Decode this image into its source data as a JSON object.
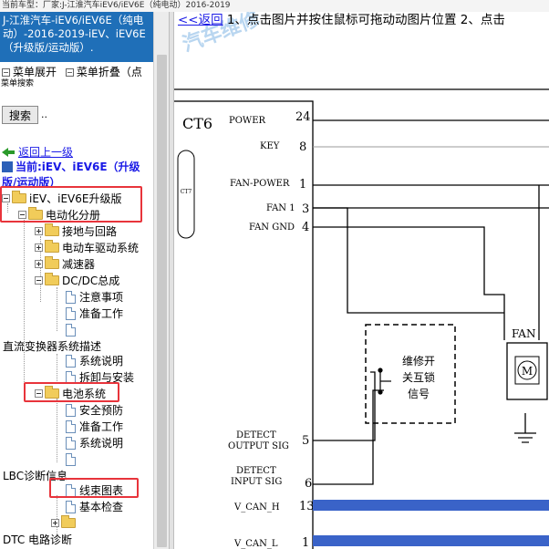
{
  "topbar": {
    "text": "当前车型：厂家:J-江淮汽车iEV6/iEV6E（纯电动）2016-2019"
  },
  "left": {
    "title": "J-江淮汽车-iEV6/iEV6E（纯电动）-2016-2019-iEV、iEV6E（升级版/运动版）.",
    "menu_expand": "菜单展开",
    "menu_collapse": "菜单折叠（点",
    "search_label": "菜单搜索",
    "search_button": "搜索",
    "search_dots": "..",
    "back_link": "返回上一级",
    "current_label": "当前:iEV、iEV6E（升级版/运动版）",
    "tree": {
      "root": "iEV、iEV6E升级版",
      "electrification": "电动化分册",
      "grounding": "接地与回路",
      "motor_drive": "电动车驱动系统",
      "reducer": "减速器",
      "dcdc": "DC/DC总成",
      "notes": "注意事项",
      "prep": "准备工作",
      "dcdc_desc": "直流变换器系统描述",
      "sys_desc": "系统说明",
      "removal": "拆卸与安装",
      "battery": "电池系统",
      "safety": "安全预防",
      "prep2": "准备工作",
      "sys_desc2": "系统说明",
      "lbc": "LBC诊断信息",
      "harness": "线束图表",
      "basic_check": "基本检查",
      "dtc": "DTC 电路诊断"
    }
  },
  "right": {
    "back": "<<返回",
    "instruction": " 1、点击图片并按住鼠标可拖动动图片位置 2、点击",
    "watermark": "汽车维修",
    "diagram": {
      "connector": "CT6",
      "connector_small": "CT7",
      "pins": [
        {
          "label": "POWER",
          "num": "24"
        },
        {
          "label": "KEY",
          "num": "8"
        },
        {
          "label": "FAN-POWER",
          "num": "1"
        },
        {
          "label": "FAN 1",
          "num": "3"
        },
        {
          "label": "FAN GND",
          "num": "4"
        },
        {
          "label": "DETECT OUTPUT SIG",
          "num": "5"
        },
        {
          "label": "DETECT INPUT SIG",
          "num": "6"
        },
        {
          "label": "V_CAN_H",
          "num": "13"
        },
        {
          "label": "V_CAN_L",
          "num": "1"
        }
      ],
      "fan_label": "FAN",
      "motor_label": "M",
      "interlock_text": [
        "维修开",
        "关互锁",
        "信号"
      ]
    }
  },
  "colors": {
    "title_bg": "#1f6fb8",
    "link": "#1a1ae6",
    "highlight": "#e8343b",
    "can_bar": "#3a63c8"
  }
}
